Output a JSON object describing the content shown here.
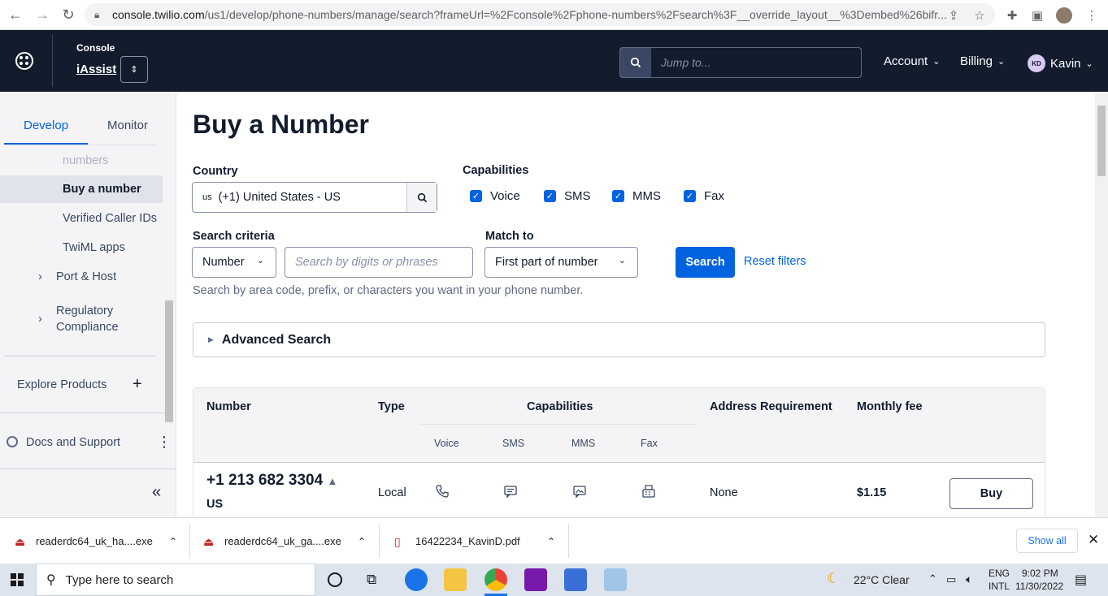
{
  "browser": {
    "url_host": "console.twilio.com",
    "url_path": "/us1/develop/phone-numbers/manage/search?frameUrl=%2Fconsole%2Fphone-numbers%2Fsearch%3F__override_layout__%3Dembed%26bifr..."
  },
  "header": {
    "console_label": "Console",
    "account_name": "iAssist",
    "search_placeholder": "Jump to...",
    "account_menu": "Account",
    "billing_menu": "Billing",
    "user_initials": "KD",
    "user_name": "Kavin"
  },
  "sidebar": {
    "tabs": [
      "Develop",
      "Monitor"
    ],
    "items": [
      {
        "label": "numbers"
      },
      {
        "label": "Buy a number"
      },
      {
        "label": "Verified Caller IDs"
      },
      {
        "label": "TwiML apps"
      },
      {
        "label": "Port & Host"
      },
      {
        "label": "Regulatory Compliance"
      }
    ],
    "explore_products": "Explore Products",
    "docs_support": "Docs and Support"
  },
  "page": {
    "title": "Buy a Number",
    "country_label": "Country",
    "country_prefix": "us",
    "country_value": "(+1) United States - US",
    "capabilities_label": "Capabilities",
    "capabilities": [
      "Voice",
      "SMS",
      "MMS",
      "Fax"
    ],
    "search_criteria_label": "Search criteria",
    "search_criteria_value": "Number",
    "search_placeholder": "Search by digits or phrases",
    "match_to_label": "Match to",
    "match_to_value": "First part of number",
    "search_button": "Search",
    "reset_link": "Reset filters",
    "help_text": "Search by area code, prefix, or characters you want in your phone number.",
    "advanced_search": "Advanced Search"
  },
  "table": {
    "headers": {
      "number": "Number",
      "type": "Type",
      "capabilities": "Capabilities",
      "address": "Address Requirement",
      "fee": "Monthly fee"
    },
    "sub_headers": [
      "Voice",
      "SMS",
      "MMS",
      "Fax"
    ],
    "rows": [
      {
        "number": "+1 213 682 3304",
        "country": "US",
        "type": "Local",
        "address": "None",
        "fee": "$1.15",
        "action": "Buy"
      }
    ]
  },
  "downloads": {
    "items": [
      "readerdc64_uk_ha....exe",
      "readerdc64_uk_ga....exe",
      "16422234_KavinD.pdf"
    ],
    "show_all": "Show all"
  },
  "taskbar": {
    "search_placeholder": "Type here to search",
    "weather": "22°C  Clear",
    "lang1": "ENG",
    "lang2": "INTL",
    "time": "9:02 PM",
    "date": "11/30/2022"
  }
}
